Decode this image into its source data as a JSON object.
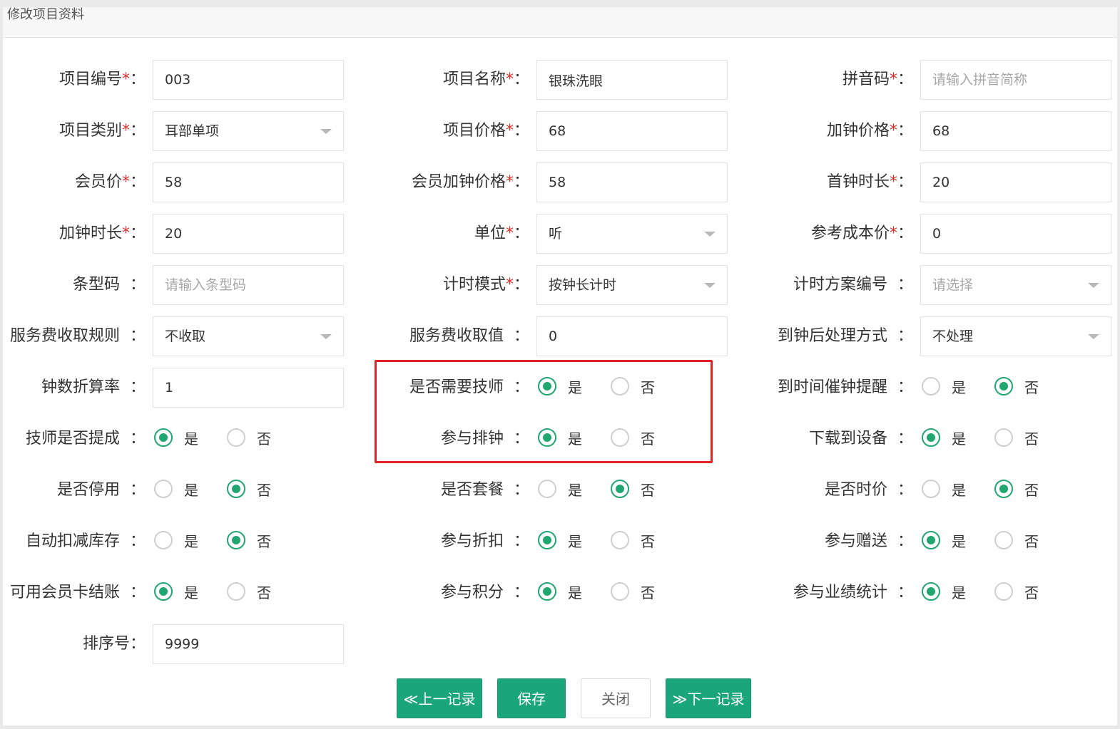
{
  "title": "修改项目资料",
  "colors": {
    "accent": "#1aa57a",
    "required": "#e0302c",
    "highlight": "#e02424"
  },
  "fields": {
    "code": {
      "label": "项目编号",
      "value": "003"
    },
    "name": {
      "label": "项目名称",
      "value": "银珠洗眼"
    },
    "pinyin": {
      "label": "拼音码",
      "value": "",
      "placeholder": "请输入拼音简称"
    },
    "category": {
      "label": "项目类别",
      "value": "耳部单项"
    },
    "price": {
      "label": "项目价格",
      "value": "68"
    },
    "extra_price": {
      "label": "加钟价格",
      "value": "68"
    },
    "member_price": {
      "label": "会员价",
      "value": "58"
    },
    "member_extra_price": {
      "label": "会员加钟价格",
      "value": "58"
    },
    "first_duration": {
      "label": "首钟时长",
      "value": "20"
    },
    "extra_duration": {
      "label": "加钟时长",
      "value": "20"
    },
    "unit": {
      "label": "单位",
      "value": "听"
    },
    "ref_cost": {
      "label": "参考成本价",
      "value": "0"
    },
    "barcode": {
      "label": "条型码",
      "value": "",
      "placeholder": "请输入条型码"
    },
    "timing_mode": {
      "label": "计时模式",
      "value": "按钟长计时"
    },
    "timing_plan": {
      "label": "计时方案编号",
      "value": "请选择"
    },
    "fee_rule": {
      "label": "服务费收取规则",
      "value": "不收取"
    },
    "fee_value": {
      "label": "服务费收取值",
      "value": "0"
    },
    "after_action": {
      "label": "到钟后处理方式",
      "value": "不处理"
    },
    "clock_rate": {
      "label": "钟数折算率",
      "value": "1"
    },
    "sort_no": {
      "label": "排序号",
      "value": "9999"
    }
  },
  "radio_yes": "是",
  "radio_no": "否",
  "colon": "：",
  "star": "*",
  "radios": {
    "need_tech": {
      "label": "是否需要技师",
      "value": "是"
    },
    "remind": {
      "label": "到时间催钟提醒",
      "value": "否"
    },
    "tech_commission": {
      "label": "技师是否提成",
      "value": "是"
    },
    "schedule": {
      "label": "参与排钟",
      "value": "是"
    },
    "download": {
      "label": "下载到设备",
      "value": "是"
    },
    "disabled": {
      "label": "是否停用",
      "value": "否"
    },
    "package": {
      "label": "是否套餐",
      "value": "否"
    },
    "time_price": {
      "label": "是否时价",
      "value": "否"
    },
    "auto_stock": {
      "label": "自动扣减库存",
      "value": "否"
    },
    "discount": {
      "label": "参与折扣",
      "value": "是"
    },
    "gift": {
      "label": "参与赠送",
      "value": "是"
    },
    "member_card": {
      "label": "可用会员卡结账",
      "value": "是"
    },
    "points": {
      "label": "参与积分",
      "value": "是"
    },
    "performance": {
      "label": "参与业绩统计",
      "value": "是"
    }
  },
  "buttons": {
    "prev": "≪上一记录",
    "save": "保存",
    "close": "关闭",
    "next": "≫下一记录"
  }
}
